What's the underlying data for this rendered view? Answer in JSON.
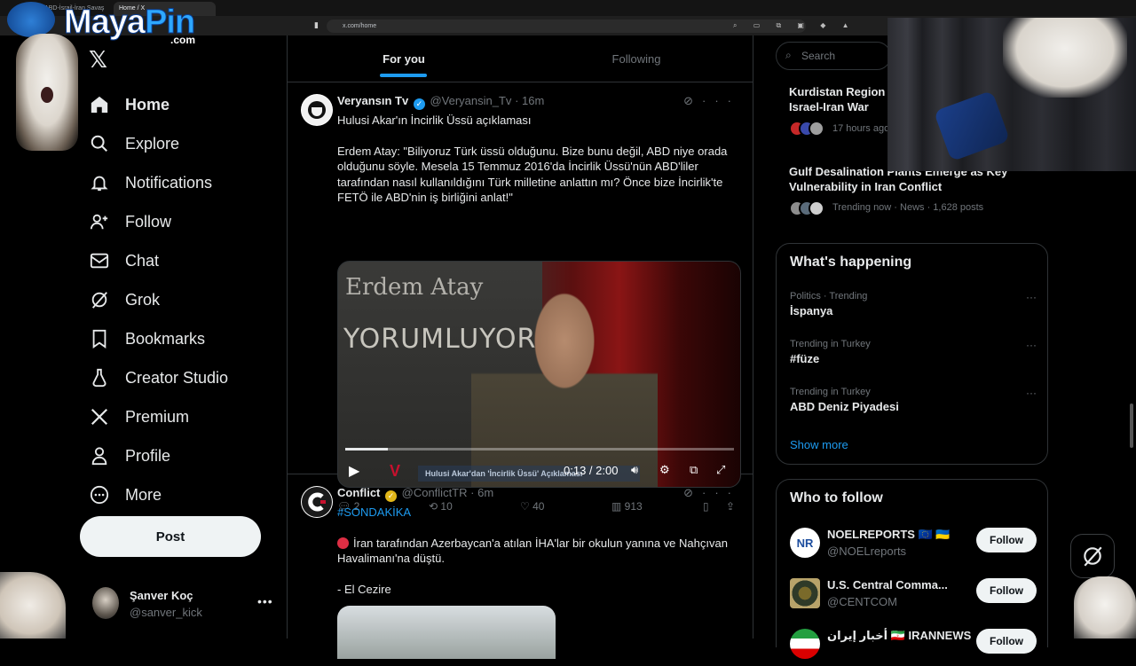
{
  "browser": {
    "tabs": [
      {
        "label": "#CANLI ABD-İsrail-İran Savaşı"
      },
      {
        "label": "Home / X"
      }
    ],
    "address": "x.com/home"
  },
  "overlay": {
    "logo_main": "Maya",
    "logo_accent": "Pin",
    "logo_suffix": ".com"
  },
  "sidebar": {
    "items": [
      {
        "label": "Home",
        "icon": "home-icon"
      },
      {
        "label": "Explore",
        "icon": "search-icon"
      },
      {
        "label": "Notifications",
        "icon": "bell-icon"
      },
      {
        "label": "Follow",
        "icon": "person-add-icon"
      },
      {
        "label": "Chat",
        "icon": "mail-icon"
      },
      {
        "label": "Grok",
        "icon": "grok-icon"
      },
      {
        "label": "Bookmarks",
        "icon": "bookmark-icon"
      },
      {
        "label": "Creator Studio",
        "icon": "creator-icon"
      },
      {
        "label": "Premium",
        "icon": "x-icon"
      },
      {
        "label": "Profile",
        "icon": "person-icon"
      },
      {
        "label": "More",
        "icon": "more-circle-icon"
      }
    ],
    "post_label": "Post",
    "account": {
      "name": "Şanver Koç",
      "handle": "@sanver_kick"
    }
  },
  "timeline": {
    "tabs": [
      {
        "label": "For you"
      },
      {
        "label": "Following"
      }
    ],
    "posts": [
      {
        "name": "Veryansın Tv",
        "handle": "@Veryansin_Tv",
        "time": "16m",
        "text1": "Hulusi Akar'ın İncirlik Üssü açıklaması",
        "text2": "Erdem Atay: \"Biliyoruz Türk üssü olduğunu. Bize bunu değil, ABD niye orada olduğunu söyle. Mesela 15 Temmuz 2016'da İncirlik Üssü'nün ABD'liler tarafından nasıl kullanıldığını Türk milletine anlattın mı? Önce bize İncirlik'te FETÖ ile ABD'nin iş birliğini anlat!\"",
        "video": {
          "board_line1": "Erdem Atay",
          "board_line2": "YORUMLUYOR",
          "ticker": "Hulusi Akar'dan 'İncirlik Üssü' Açıklaması",
          "time": "0:13 / 2:00",
          "progress": 0.11
        },
        "replies": "2",
        "reposts": "10",
        "likes": "40",
        "views": "913"
      },
      {
        "name": "Conflict",
        "handle": "@ConflictTR",
        "time": "6m",
        "hashtag": "#SONDAKİKA",
        "text1": "İran tarafından Azerbaycan'a atılan İHA'lar bir okulun yanına ve Nahçıvan Havalimanı'na düştü.",
        "text2": "- El Cezire"
      }
    ]
  },
  "right": {
    "search_placeholder": "Search",
    "news": [
      {
        "title1": "Kurdistan Region",
        "title2": "Israel-Iran War",
        "sub": "17 hours ago"
      },
      {
        "title": "Gulf Desalination Plants Emerge as Key Vulnerability in Iran Conflict",
        "sub": "Trending now · News · 1,628 posts"
      }
    ],
    "whats_happening": {
      "title": "What's happening",
      "items": [
        {
          "context": "Politics · Trending",
          "topic": "İspanya"
        },
        {
          "context": "Trending in Turkey",
          "topic": "#füze"
        },
        {
          "context": "Trending in Turkey",
          "topic": "ABD Deniz Piyadesi"
        }
      ],
      "show_more": "Show more"
    },
    "who_to_follow": {
      "title": "Who to follow",
      "follow_label": "Follow",
      "accounts": [
        {
          "name": "NOELREPORTS 🇪🇺 🇺🇦",
          "handle": "@NOELreports",
          "avatar_text": "NR"
        },
        {
          "name": "U.S. Central Comma...",
          "handle": "@CENTCOM",
          "avatar_text": ""
        },
        {
          "name": "أخبار إيران 🇮🇷 IRANNEWS",
          "handle": "",
          "avatar_text": ""
        }
      ]
    }
  },
  "colors": {
    "accent": "#1d9bf0",
    "background": "#000000",
    "border": "#2f3336",
    "muted": "#71767b"
  }
}
